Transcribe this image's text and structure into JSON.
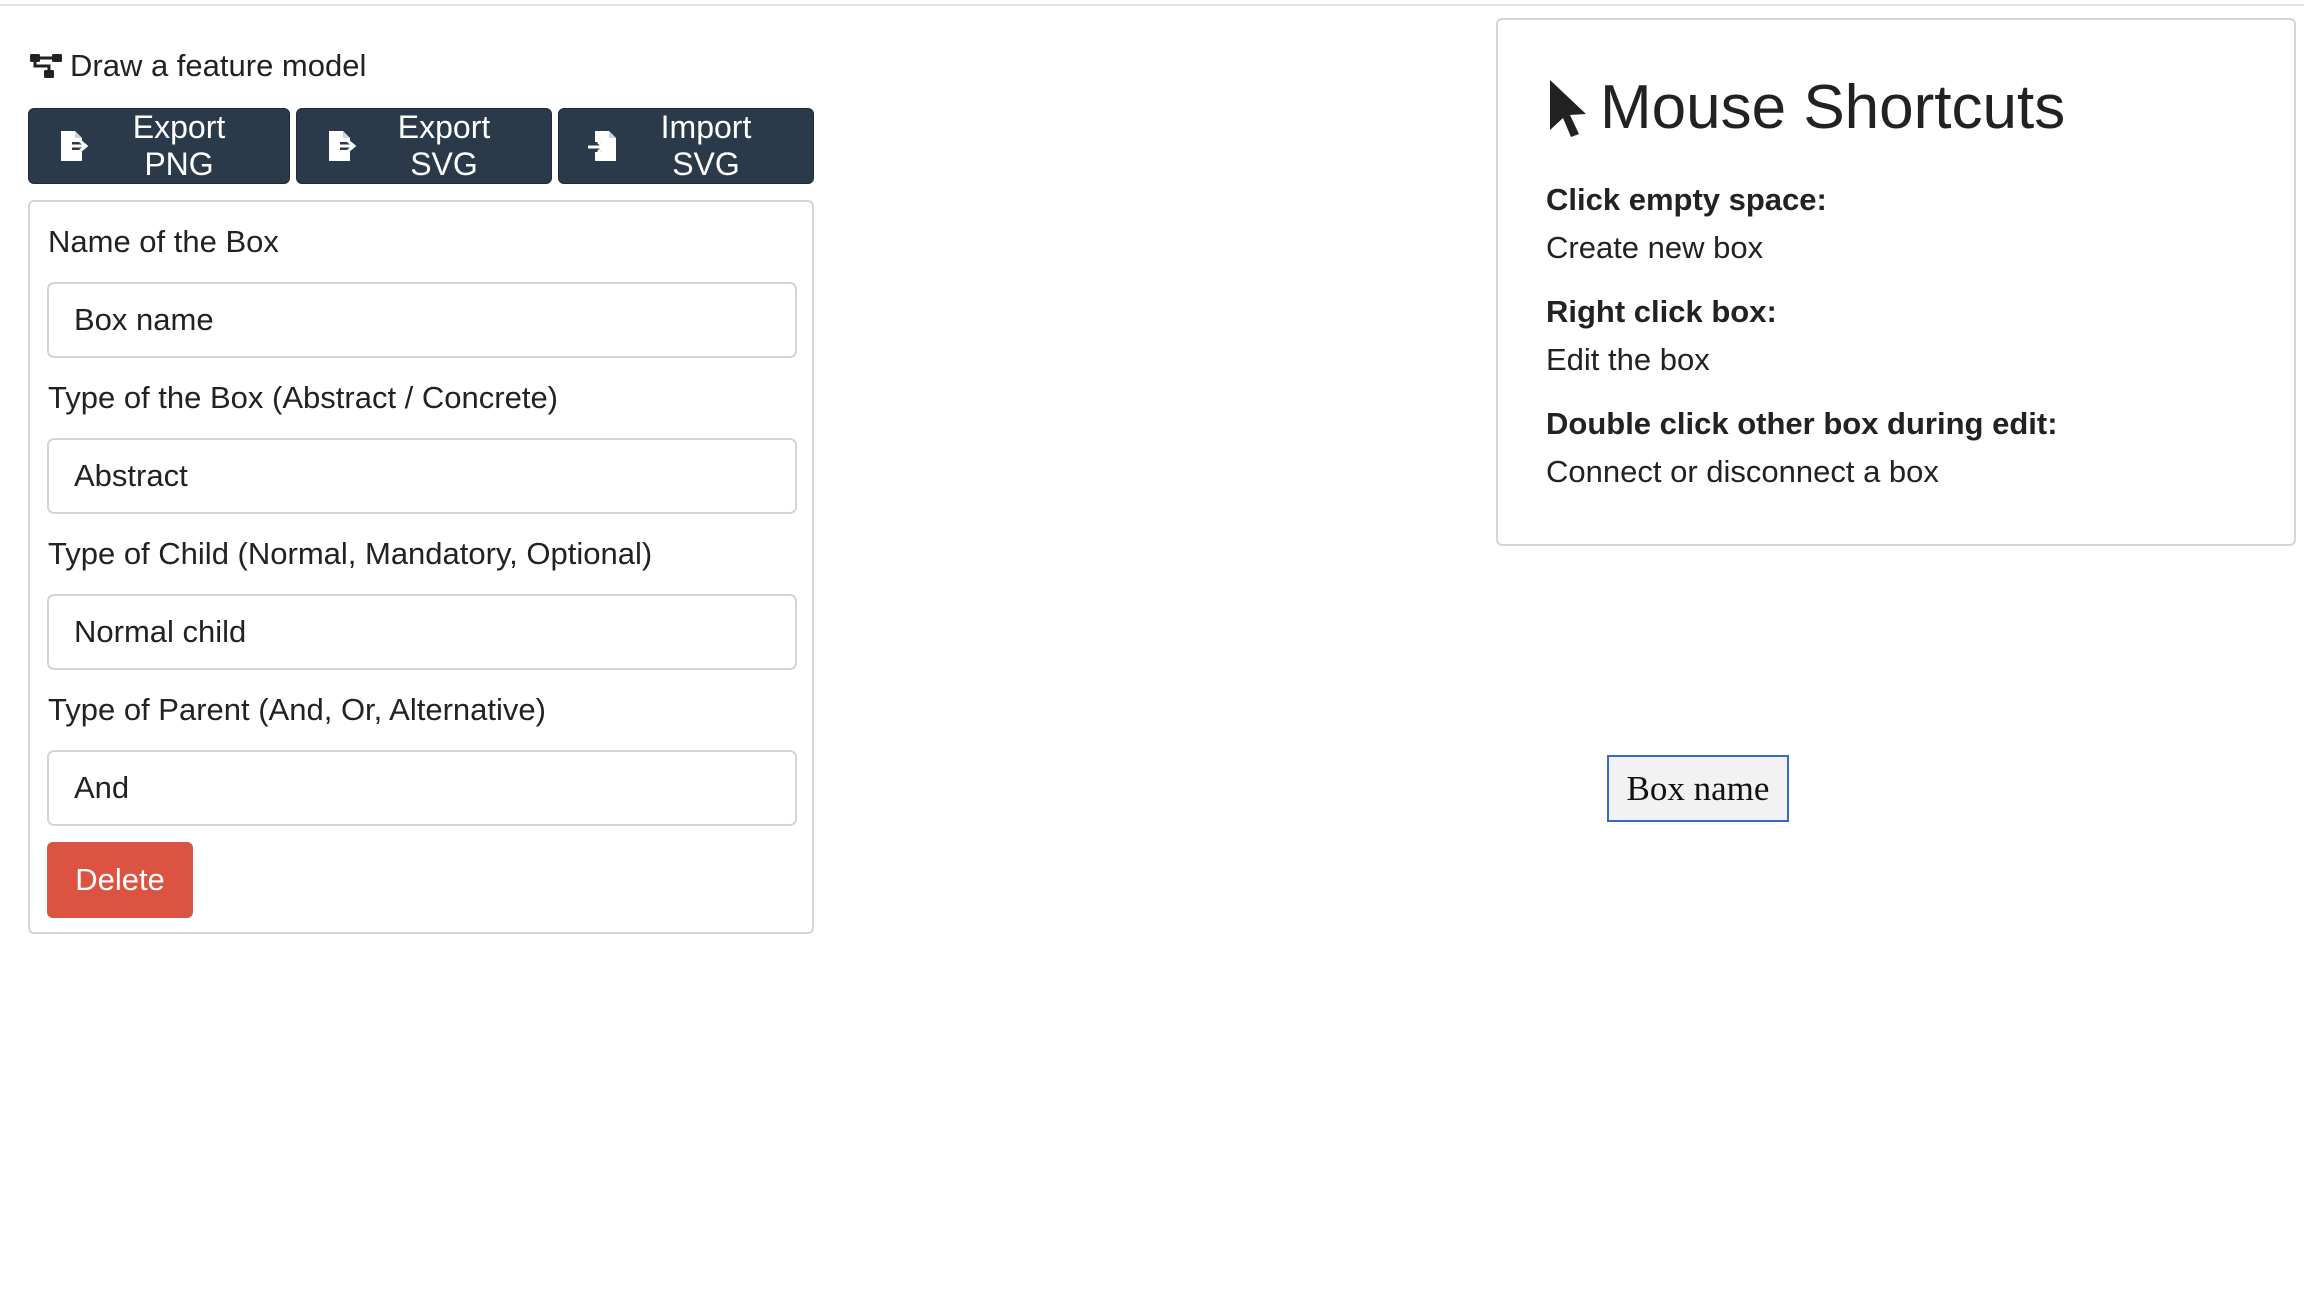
{
  "app": {
    "title": "Draw a feature model",
    "icon": "sitemap-icon"
  },
  "toolbar": {
    "export_png_label": "Export PNG",
    "export_svg_label": "Export SVG",
    "import_svg_label": "Import SVG",
    "export_icon": "file-export-icon",
    "import_icon": "file-import-icon",
    "button_color": "#2b3a4a"
  },
  "editor": {
    "name_label": "Name of the Box",
    "name_value": "Box name",
    "type_label": "Type of the Box (Abstract / Concrete)",
    "type_value": "Abstract",
    "child_label": "Type of Child (Normal, Mandatory, Optional)",
    "child_value": "Normal child",
    "parent_label": "Type of Parent (And, Or, Alternative)",
    "parent_value": "And",
    "delete_label": "Delete",
    "delete_color": "#dc5342"
  },
  "shortcuts": {
    "title": "Mouse Shortcuts",
    "icon": "mouse-pointer-icon",
    "items": [
      {
        "key": "Click empty space:",
        "desc": "Create new box"
      },
      {
        "key": "Right click box:",
        "desc": "Edit the box"
      },
      {
        "key": "Double click other box during edit:",
        "desc": "Connect or disconnect a box"
      }
    ]
  },
  "canvas": {
    "box_label": "Box name",
    "selected_border_color": "#3a68c8"
  }
}
